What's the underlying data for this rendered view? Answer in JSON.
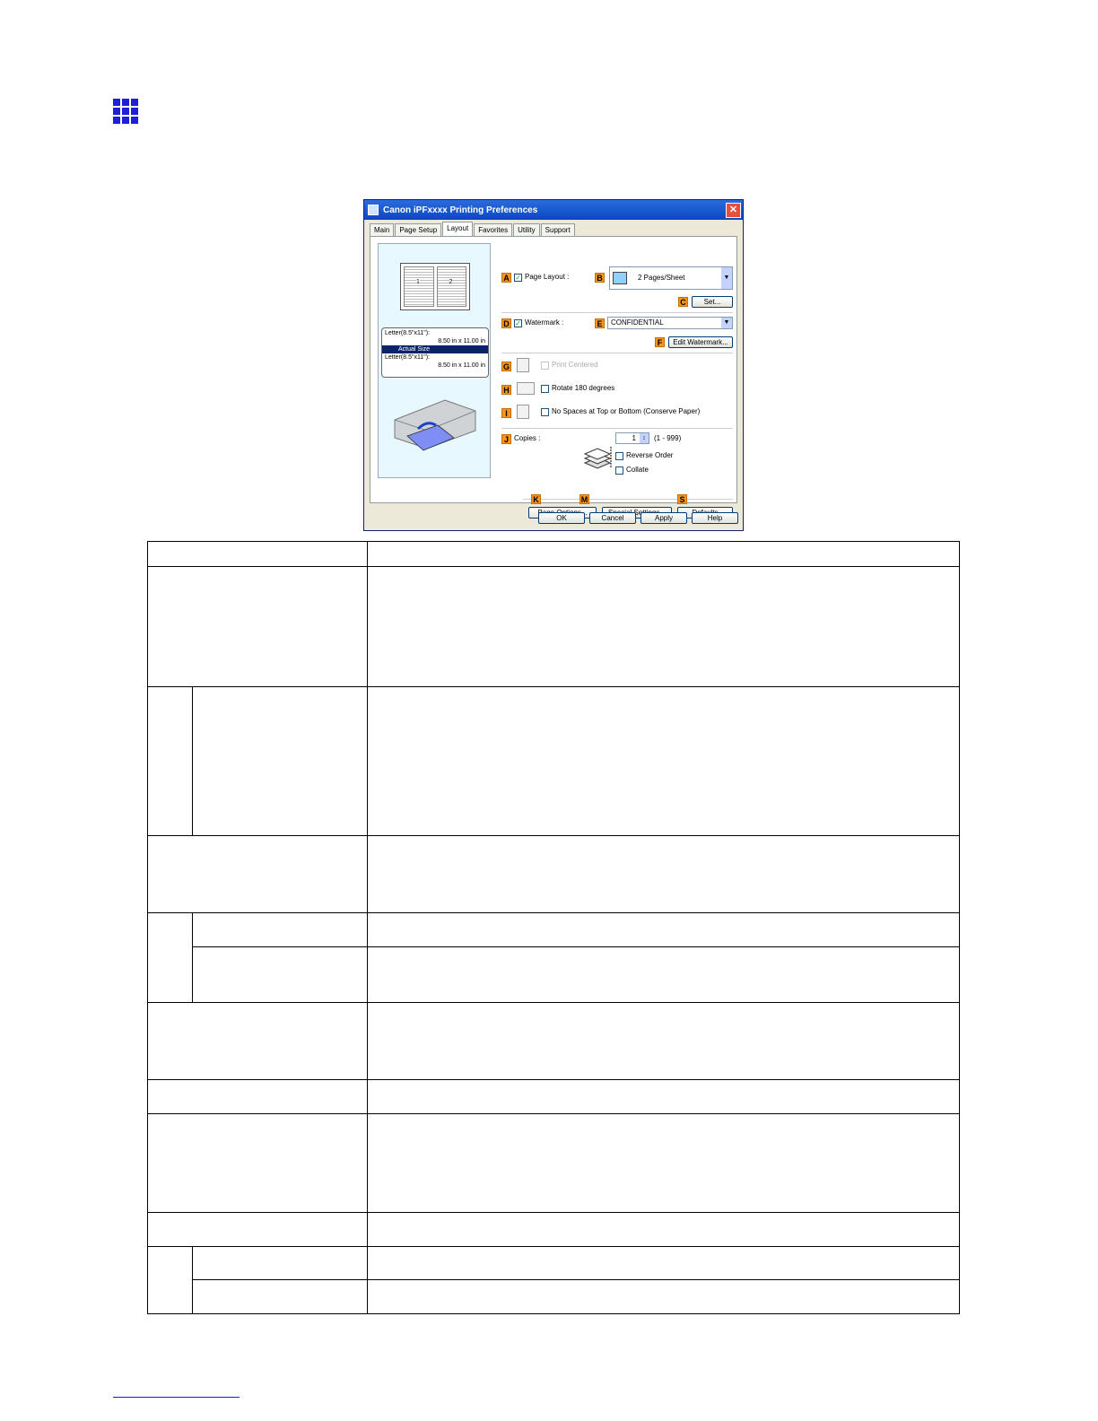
{
  "dialog": {
    "title": "Canon iPFxxxx Printing Preferences",
    "close": "✕",
    "tabs": [
      "Main",
      "Page Setup",
      "Layout",
      "Favorites",
      "Utility",
      "Support"
    ],
    "active_tab": "Layout",
    "preview": {
      "page1": "1",
      "page2": "2",
      "size_line1": "Letter(8.5\"x11\"):",
      "size_line2": "8.50 in x 11.00 in",
      "actual_size": "Actual Size",
      "size_line3": "Letter(8.5\"x11\"):",
      "size_line4": "8.50 in x 11.00 in"
    },
    "labels": {
      "A": "A",
      "B": "B",
      "C": "C",
      "D": "D",
      "E": "E",
      "F": "F",
      "G": "G",
      "H": "H",
      "I": "I",
      "J": "J",
      "K": "K",
      "M": "M",
      "S": "S"
    },
    "page_layout": "Page Layout :",
    "pages_per_sheet": "2 Pages/Sheet",
    "set": "Set...",
    "watermark": "Watermark :",
    "watermark_value": "CONFIDENTIAL",
    "edit_watermark": "Edit Watermark...",
    "print_centered": "Print Centered",
    "rotate": "Rotate 180 degrees",
    "no_spaces": "No Spaces at Top or Bottom (Conserve Paper)",
    "copies": "Copies :",
    "copies_value": "1",
    "copies_range": "(1 - 999)",
    "reverse_order": "Reverse Order",
    "collate": "Collate",
    "page_options": "Page Options...",
    "special_settings": "Special Settings...",
    "defaults": "Defaults",
    "ok": "OK",
    "cancel": "Cancel",
    "apply": "Apply",
    "help": "Help",
    "check": "✓",
    "arrow": "▼"
  }
}
